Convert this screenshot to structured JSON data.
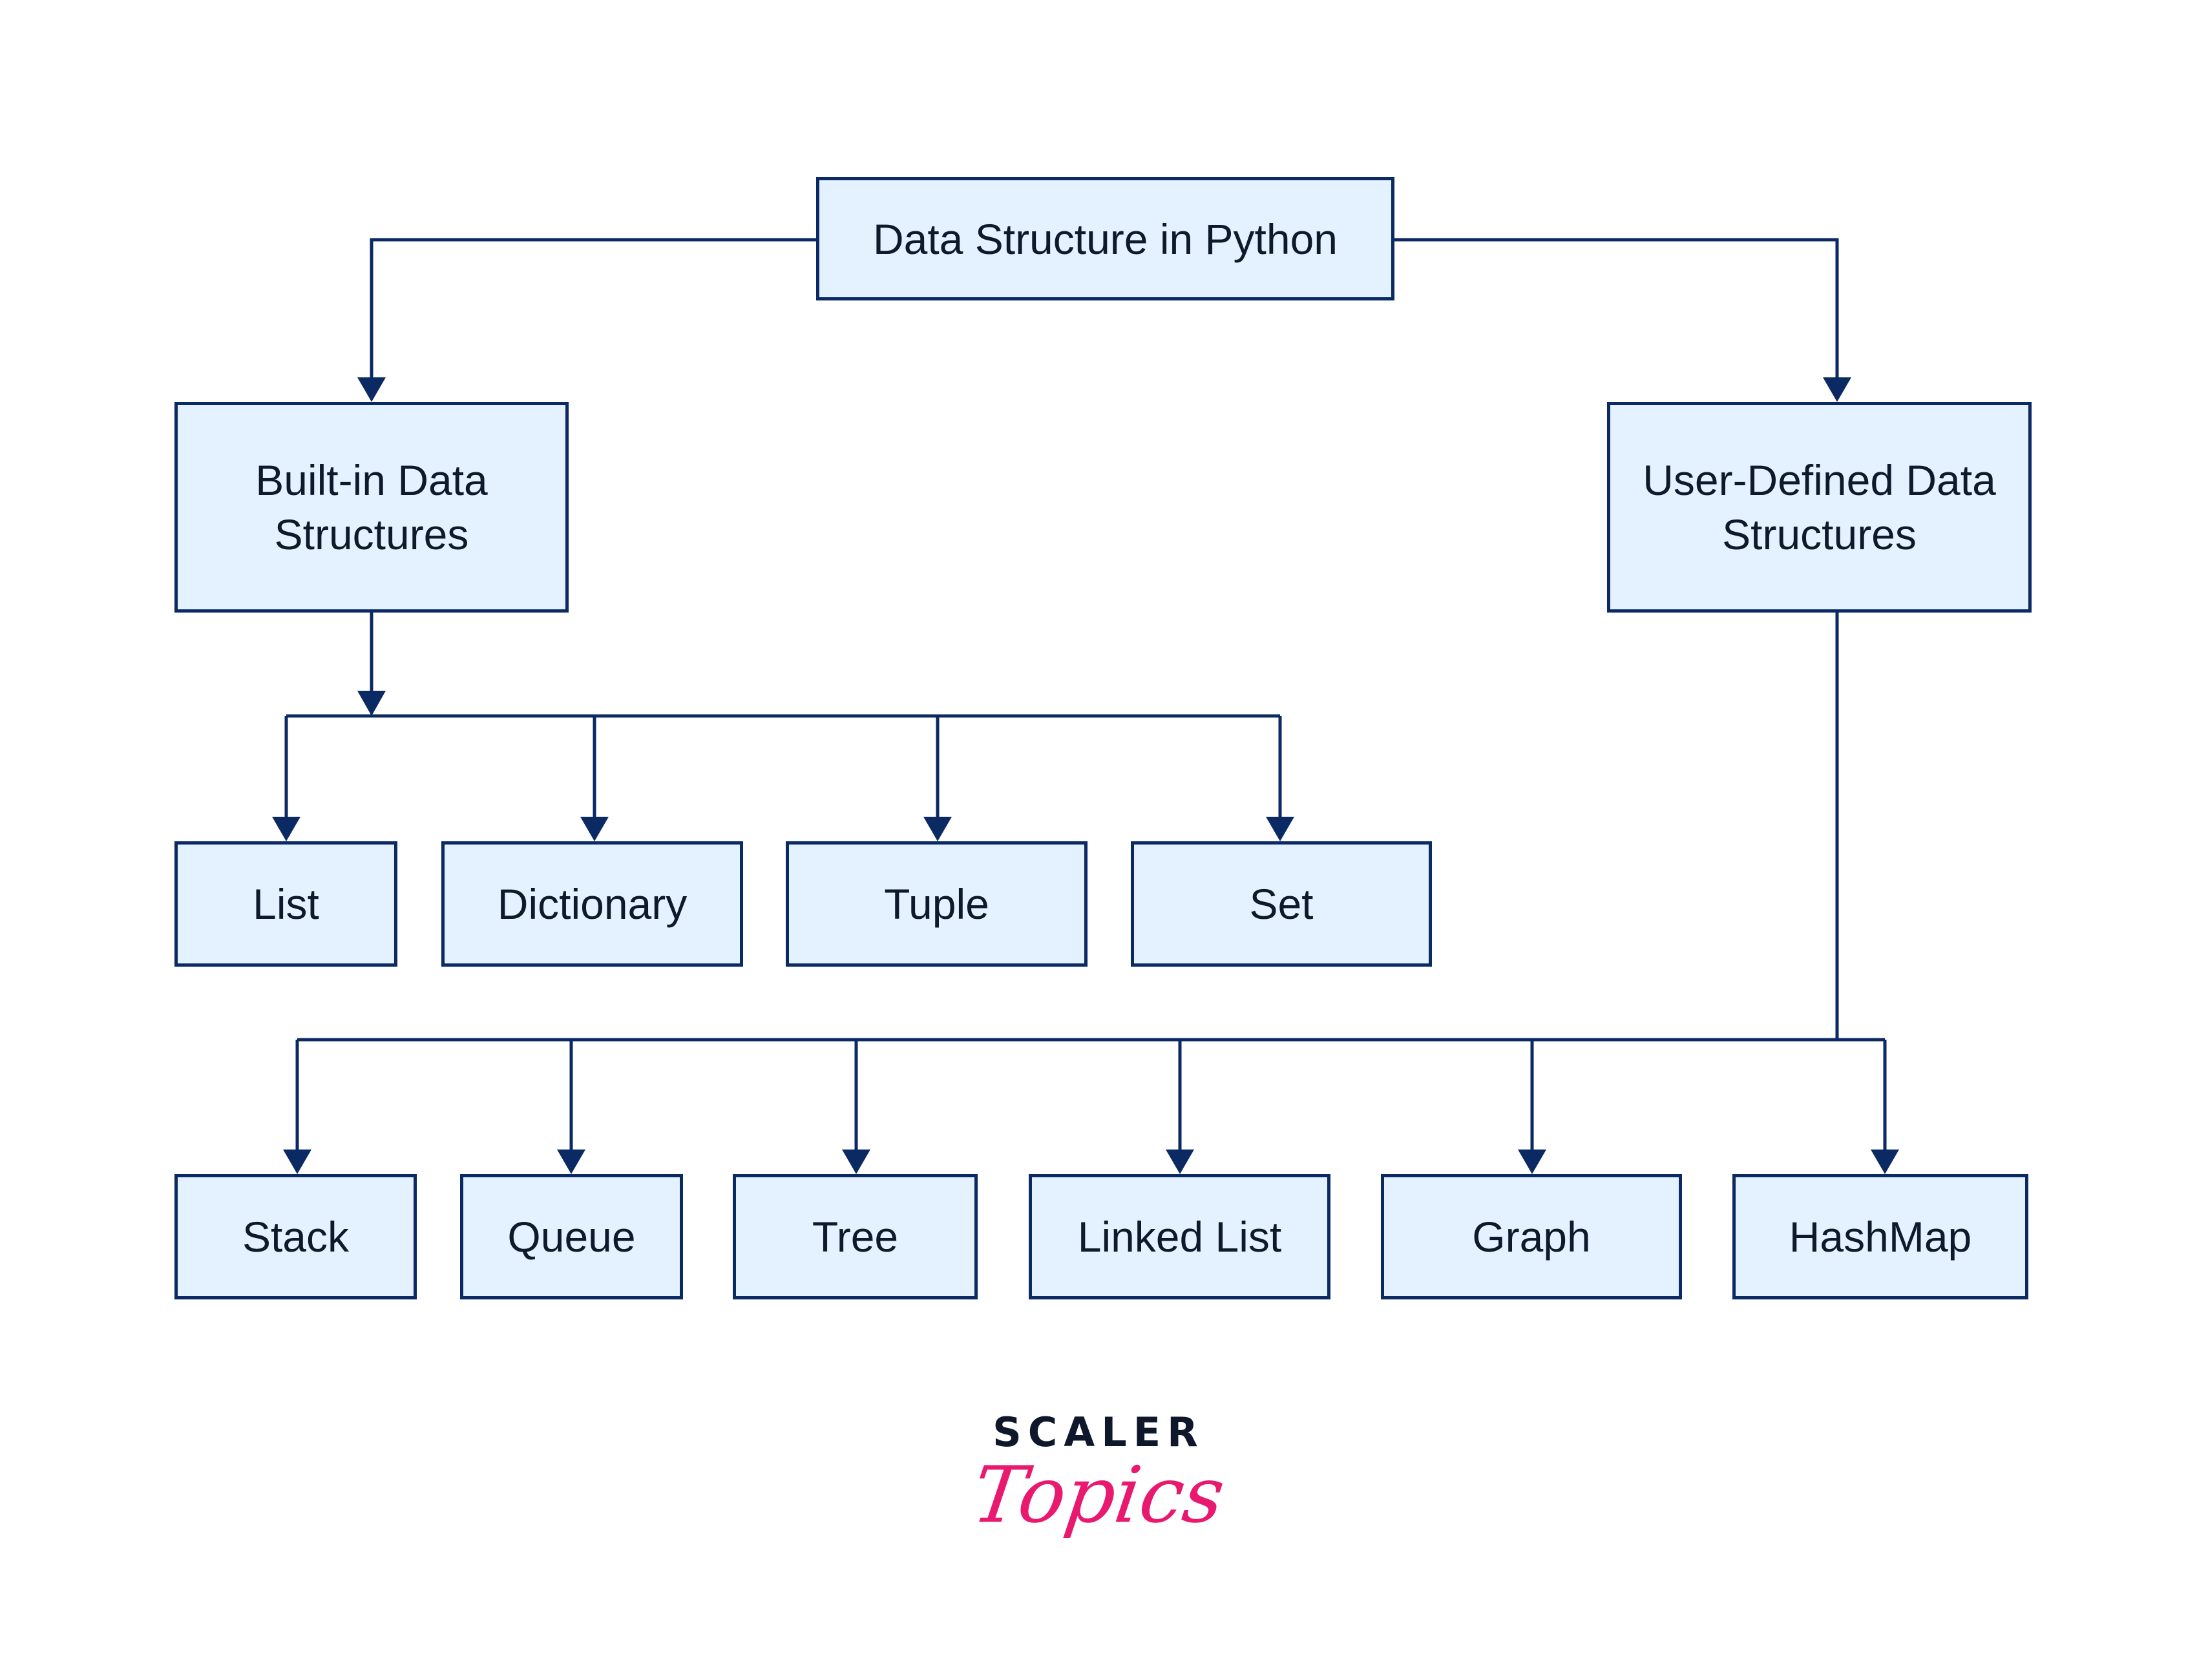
{
  "diagram": {
    "title": "Data Structure in Python",
    "colors": {
      "box_fill": "#e3f2fe",
      "box_border": "#0b2a63",
      "connector": "#0b2a63",
      "text": "#0e1a2b",
      "logo_dark": "#0f172a",
      "logo_accent": "#e8196f"
    },
    "nodes": {
      "root": {
        "label": "Data Structure in Python"
      },
      "builtin": {
        "label_line1": "Built-in Data",
        "label_line2": "Structures"
      },
      "userdefined": {
        "label_line1": "User-Defined Data",
        "label_line2": "Structures"
      },
      "builtin_children": [
        {
          "label": "List"
        },
        {
          "label": "Dictionary"
        },
        {
          "label": "Tuple"
        },
        {
          "label": "Set"
        }
      ],
      "userdefined_children": [
        {
          "label": "Stack"
        },
        {
          "label": "Queue"
        },
        {
          "label": "Tree"
        },
        {
          "label": "Linked List"
        },
        {
          "label": "Graph"
        },
        {
          "label": "HashMap"
        }
      ]
    },
    "edges": [
      {
        "from": "Data Structure in Python",
        "to": "Built-in Data Structures"
      },
      {
        "from": "Data Structure in Python",
        "to": "User-Defined Data Structures"
      },
      {
        "from": "Built-in Data Structures",
        "to": "List"
      },
      {
        "from": "Built-in Data Structures",
        "to": "Dictionary"
      },
      {
        "from": "Built-in Data Structures",
        "to": "Tuple"
      },
      {
        "from": "Built-in Data Structures",
        "to": "Set"
      },
      {
        "from": "User-Defined Data Structures",
        "to": "Stack"
      },
      {
        "from": "User-Defined Data Structures",
        "to": "Queue"
      },
      {
        "from": "User-Defined Data Structures",
        "to": "Tree"
      },
      {
        "from": "User-Defined Data Structures",
        "to": "Linked List"
      },
      {
        "from": "User-Defined Data Structures",
        "to": "Graph"
      },
      {
        "from": "User-Defined Data Structures",
        "to": "HashMap"
      }
    ]
  },
  "logo": {
    "brand": "SCALER",
    "product": "Topics"
  }
}
